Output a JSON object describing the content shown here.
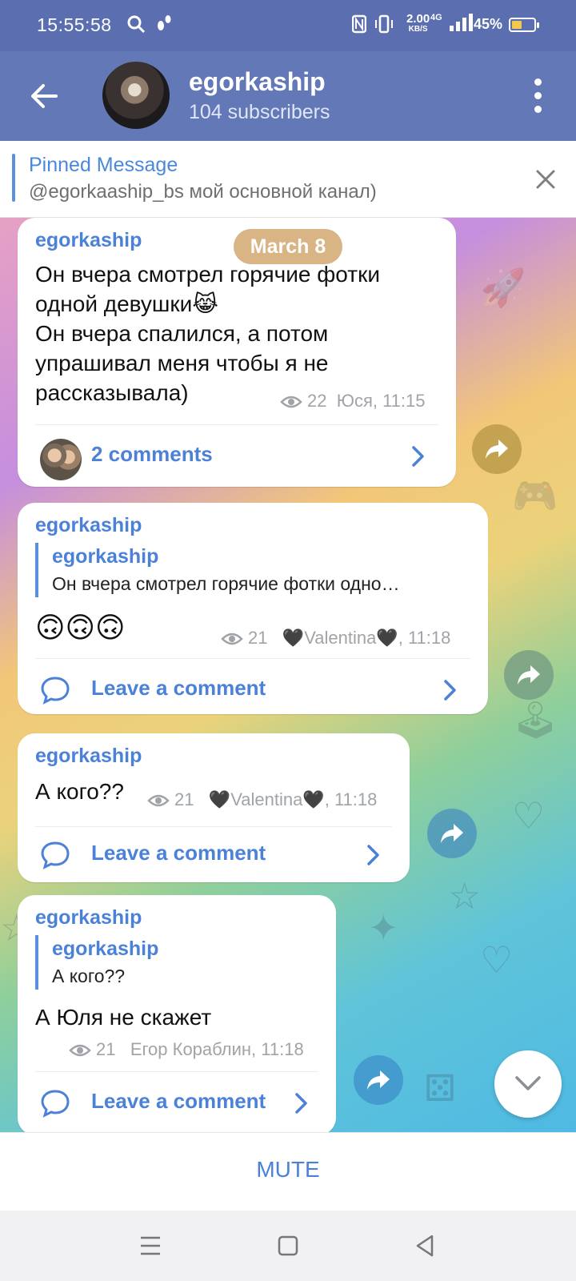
{
  "status_bar": {
    "time": "15:55:58",
    "speed_value": "2.00",
    "speed_unit": "KB/S",
    "network": "4G",
    "battery": "45%"
  },
  "header": {
    "title": "egorkaship",
    "subtitle": "104 subscribers"
  },
  "pinned": {
    "title": "Pinned Message",
    "text": "@egorkaaship_bs мой основной канал)"
  },
  "date_label": "March 8",
  "messages": [
    {
      "author": "egorkaship",
      "text": "Он вчера смотрел горячие фотки одной девушки😹\nОн вчера спалился, а потом упрашивал меня чтобы я не рассказывала)",
      "views": "22",
      "signature": "Юся, 11:15",
      "comments_label": "2 comments"
    },
    {
      "author": "egorkaship",
      "reply_author": "egorkaship",
      "reply_text": "Он вчера смотрел горячие фотки одно…",
      "text": "🙃🙃🙃",
      "views": "21",
      "signature": "🖤Valentina🖤, 11:18",
      "comments_label": "Leave a comment"
    },
    {
      "author": "egorkaship",
      "text": "А кого??",
      "views": "21",
      "signature": "🖤Valentina🖤, 11:18",
      "comments_label": "Leave a comment"
    },
    {
      "author": "egorkaship",
      "reply_author": "egorkaship",
      "reply_text": "А кого??",
      "text": "А Юля не скажет",
      "views": "21",
      "signature": "Егор Кораблин, 11:18",
      "comments_label": "Leave a comment"
    }
  ],
  "mute_label": "MUTE",
  "colors": {
    "header": "#6378b6",
    "accent": "#4b82d8",
    "date_pill": "#d6ae7a"
  }
}
